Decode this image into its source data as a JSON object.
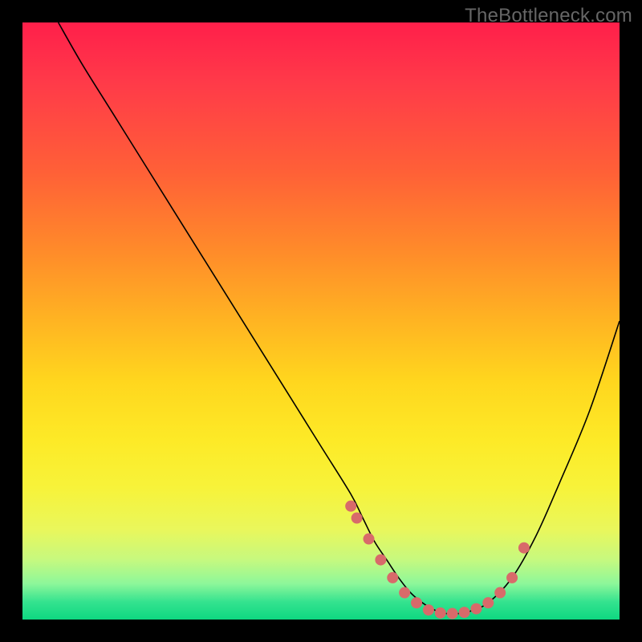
{
  "watermark": "TheBottleneck.com",
  "chart_data": {
    "type": "line",
    "title": "",
    "xlabel": "",
    "ylabel": "",
    "xlim": [
      0,
      100
    ],
    "ylim": [
      0,
      100
    ],
    "grid": false,
    "legend": false,
    "series": [
      {
        "name": "curve",
        "x": [
          6,
          10,
          15,
          20,
          25,
          30,
          35,
          40,
          45,
          50,
          55,
          57,
          59,
          61,
          63,
          65,
          67,
          69,
          71,
          73,
          75,
          78,
          82,
          86,
          90,
          95,
          100
        ],
        "y": [
          100,
          93,
          85,
          77,
          69,
          61,
          53,
          45,
          37,
          29,
          21,
          17,
          13,
          10,
          7,
          4.5,
          2.8,
          1.6,
          1.0,
          1.0,
          1.4,
          2.8,
          7,
          14,
          23,
          35,
          50
        ]
      }
    ],
    "points": {
      "name": "markers",
      "color": "#d86a6a",
      "x": [
        55,
        56,
        58,
        60,
        62,
        64,
        66,
        68,
        70,
        72,
        74,
        76,
        78,
        80,
        82,
        84
      ],
      "y": [
        19,
        17,
        13.5,
        10,
        7,
        4.5,
        2.8,
        1.6,
        1.1,
        1.0,
        1.2,
        1.8,
        2.8,
        4.5,
        7,
        12
      ]
    },
    "colors": {
      "gradient_top": "#ff1f4a",
      "gradient_bottom": "#0ed781",
      "curve": "#000000",
      "markers": "#d86a6a",
      "frame": "#000000"
    }
  }
}
